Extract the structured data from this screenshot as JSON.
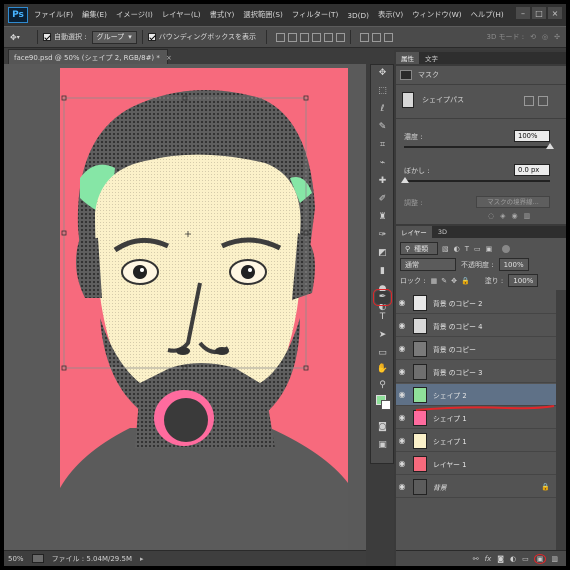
{
  "app": {
    "logo": "Ps"
  },
  "menu": [
    "ファイル(F)",
    "編集(E)",
    "イメージ(I)",
    "レイヤー(L)",
    "書式(Y)",
    "選択範囲(S)",
    "フィルター(T)",
    "3D(D)",
    "表示(V)",
    "ウィンドウ(W)",
    "ヘルプ(H)"
  ],
  "window_controls": {
    "minimize": "–",
    "maximize": "□",
    "close": "×"
  },
  "options": {
    "auto_select_label": "自動選択 :",
    "auto_select_checked": true,
    "auto_select_value": "グループ",
    "bbox_label": "バウンディングボックスを表示",
    "bbox_checked": true,
    "mode3d": "3D モード :"
  },
  "document": {
    "tab_title": "face90.psd @ 50% (シェイプ 2, RGB/8#) *"
  },
  "status": {
    "zoom": "50%",
    "file_info": "ファイル : 5.04M/29.5M"
  },
  "colors": {
    "foreground": "#8fe09a",
    "background": "#ffffff",
    "canvas_bg": "#f76a7d",
    "selected_layer": "#5f7187",
    "annotation": "#e0262a"
  },
  "properties": {
    "tabs": [
      "属性",
      "文字"
    ],
    "header_label": "マスク",
    "shape_path_label": "シェイプパス",
    "density_label": "濃度 :",
    "density_value": "100%",
    "feather_label": "ぼかし :",
    "feather_value": "0.0 px",
    "adjust_label": "調整 :",
    "mask_edge_button": "マスクの境界線..."
  },
  "layers_panel": {
    "tabs": [
      "レイヤー",
      "3D"
    ],
    "filter_kind": "種類",
    "blend_mode": "通常",
    "opacity_label": "不透明度 :",
    "opacity_value": "100%",
    "lock_label": "ロック :",
    "fill_label": "塗り :",
    "fill_value": "100%",
    "layers": [
      {
        "name": "背景 のコピー 2",
        "visible": true,
        "thumb": "bw"
      },
      {
        "name": "背景 のコピー 4",
        "visible": true,
        "thumb": "bw"
      },
      {
        "name": "背景 のコピー",
        "visible": true,
        "thumb": "face"
      },
      {
        "name": "背景 のコピー 3",
        "visible": true,
        "thumb": "face"
      },
      {
        "name": "シェイプ 2",
        "visible": true,
        "thumb": "green",
        "selected": true
      },
      {
        "name": "シェイプ 1",
        "visible": true,
        "thumb": "pink"
      },
      {
        "name": "シェイプ 1",
        "visible": true,
        "thumb": "cream"
      },
      {
        "name": "レイヤー 1",
        "visible": true,
        "thumb": "pinksolid"
      },
      {
        "name": "背景",
        "visible": true,
        "thumb": "face",
        "italic": true,
        "locked": true
      }
    ],
    "footer_icons": [
      "link-icon",
      "fx-icon",
      "mask-icon",
      "adjustment-icon",
      "folder-icon",
      "new-layer-icon",
      "trash-icon"
    ]
  },
  "tools": [
    "move-icon",
    "marquee-icon",
    "lasso-icon",
    "quick-select-icon",
    "crop-icon",
    "eyedropper-icon",
    "healing-brush-icon",
    "brush-icon",
    "clone-stamp-icon",
    "history-brush-icon",
    "eraser-icon",
    "gradient-icon",
    "blur-icon",
    "dodge-icon",
    "pen-icon",
    "type-icon",
    "path-select-icon",
    "shape-icon",
    "hand-icon",
    "zoom-icon"
  ]
}
